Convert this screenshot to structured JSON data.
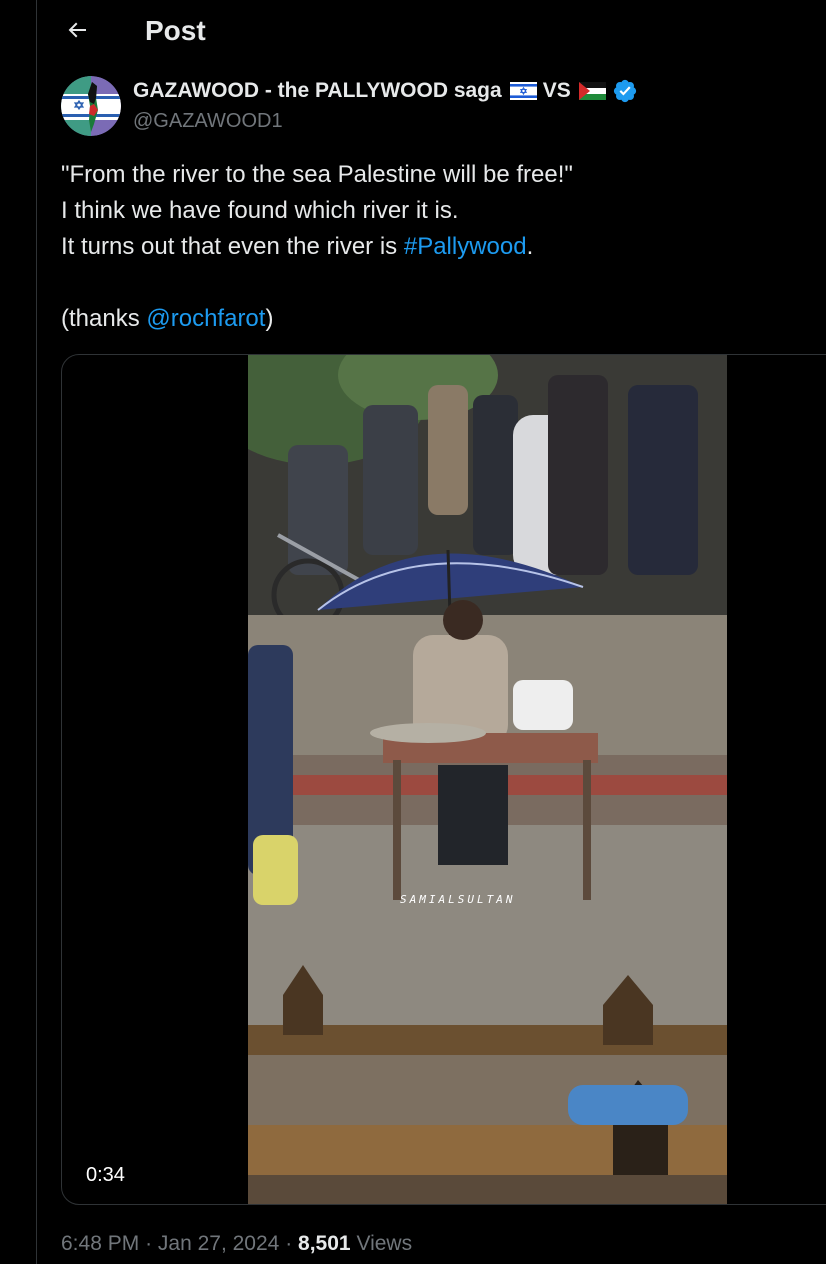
{
  "header": {
    "title": "Post",
    "back_icon": "arrow-left-icon"
  },
  "author": {
    "name": "GAZAWOOD - the PALLYWOOD saga",
    "vs_text": "VS",
    "handle": "@GAZAWOOD1",
    "flags": [
      "israel-flag-icon",
      "palestine-flag-icon"
    ],
    "verified_icon": "verified-badge-icon",
    "verified_color": "#1d9bf0"
  },
  "tweet": {
    "line1": "\"From the river to the sea Palestine will be free!\"",
    "line2": "I think we have found which river it is.",
    "line3_prefix": "It turns out that even the river is ",
    "hashtag": "#Pallywood",
    "line3_suffix": ".",
    "line5_prefix": "(thanks ",
    "mention": "@rochfarot",
    "line5_suffix": ")"
  },
  "media": {
    "duration": "0:34",
    "watermark": "SAMIALSULTAN"
  },
  "meta": {
    "time": "6:48 PM",
    "separator": "·",
    "date": "Jan 27, 2024",
    "views_count": "8,501",
    "views_label": "Views"
  },
  "colors": {
    "background": "#000000",
    "text": "#e7e9ea",
    "secondary": "#71767b",
    "link": "#1d9bf0",
    "border": "#2f3336"
  }
}
